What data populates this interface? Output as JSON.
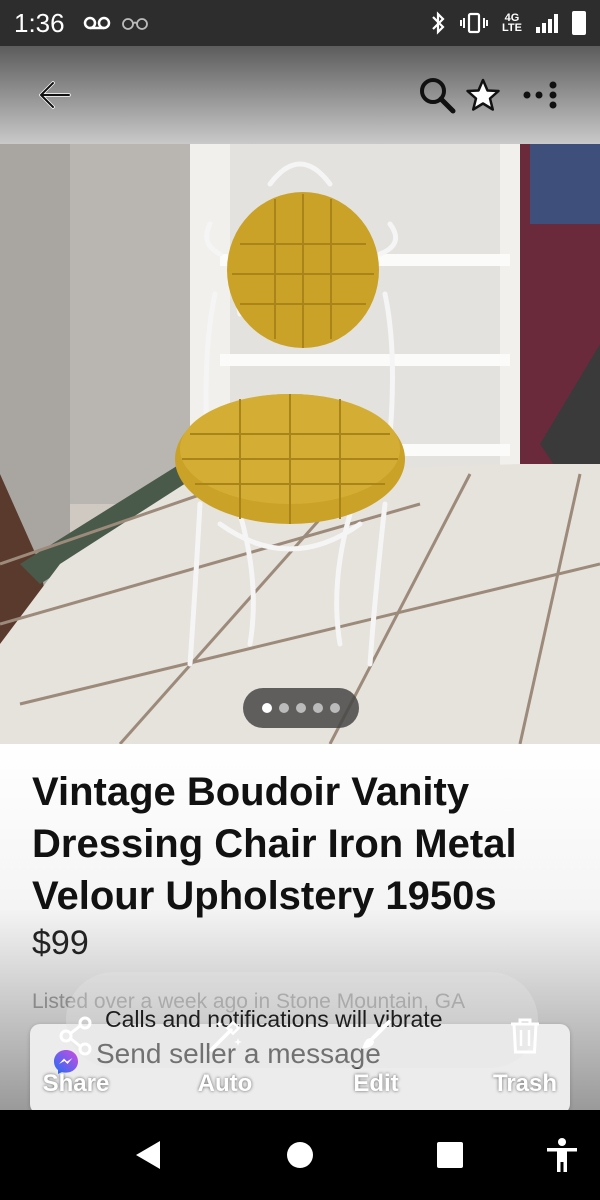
{
  "status_bar": {
    "time": "1:36",
    "network": "4G",
    "network_sub": "LTE"
  },
  "app_bar": {
    "icons": [
      "back-arrow-icon",
      "search-icon",
      "star-icon",
      "more-icon"
    ]
  },
  "gallery": {
    "image_count": 5,
    "active_index": 0
  },
  "listing": {
    "title": "Vintage Boudoir Vanity Dressing Chair Iron Metal Velour Upholstery 1950s",
    "price": "$99",
    "listed_text": "Listed over a week ago in Stone Mountain, GA"
  },
  "message": {
    "text": "Send seller a message"
  },
  "toast": {
    "text": "Calls and notifications will vibrate"
  },
  "actions": [
    {
      "label": "Share",
      "icon": "share-icon"
    },
    {
      "label": "Auto",
      "icon": "magic-wand-icon"
    },
    {
      "label": "Edit",
      "icon": "brush-icon"
    },
    {
      "label": "Trash",
      "icon": "trash-icon"
    }
  ],
  "colors": {
    "chair_cushion": "#c9a227",
    "app_bar_top": "#5c5c5c",
    "nav_bar": "#000000"
  }
}
